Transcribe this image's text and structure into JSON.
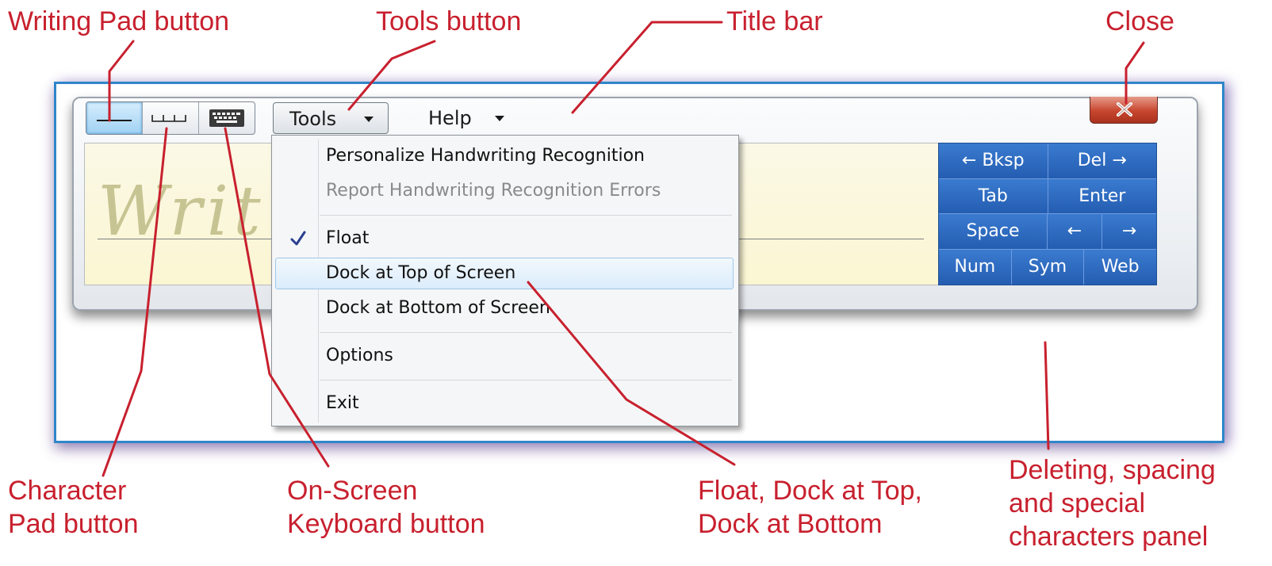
{
  "callouts": {
    "writing_pad": "Writing Pad button",
    "tools": "Tools button",
    "title_bar": "Title bar",
    "close": "Close",
    "character_pad_1": "Character",
    "character_pad_2": "Pad button",
    "keyboard_1": "On-Screen",
    "keyboard_2": "Keyboard button",
    "dock_1": "Float, Dock at Top,",
    "dock_2": "Dock at Bottom",
    "panel_1": "Deleting, spacing",
    "panel_2": "and special",
    "panel_3": "characters panel"
  },
  "toolbar": {
    "tools_label": "Tools",
    "help_label": "Help"
  },
  "pad": {
    "watermark": "Writ"
  },
  "menu": {
    "personalize": "Personalize Handwriting Recognition",
    "report": "Report Handwriting Recognition Errors",
    "float": "Float",
    "dock_top": "Dock at Top of Screen",
    "dock_bottom": "Dock at Bottom of Screen",
    "options": "Options",
    "exit": "Exit"
  },
  "keys": {
    "bksp": "← Bksp",
    "del": "Del →",
    "tab": "Tab",
    "enter": "Enter",
    "space": "Space",
    "left": "←",
    "right": "→",
    "num": "Num",
    "sym": "Sym",
    "web": "Web"
  },
  "colors": {
    "callout": "#c8202e",
    "keys_panel": "#2664b7",
    "frame": "#2f86c9"
  }
}
